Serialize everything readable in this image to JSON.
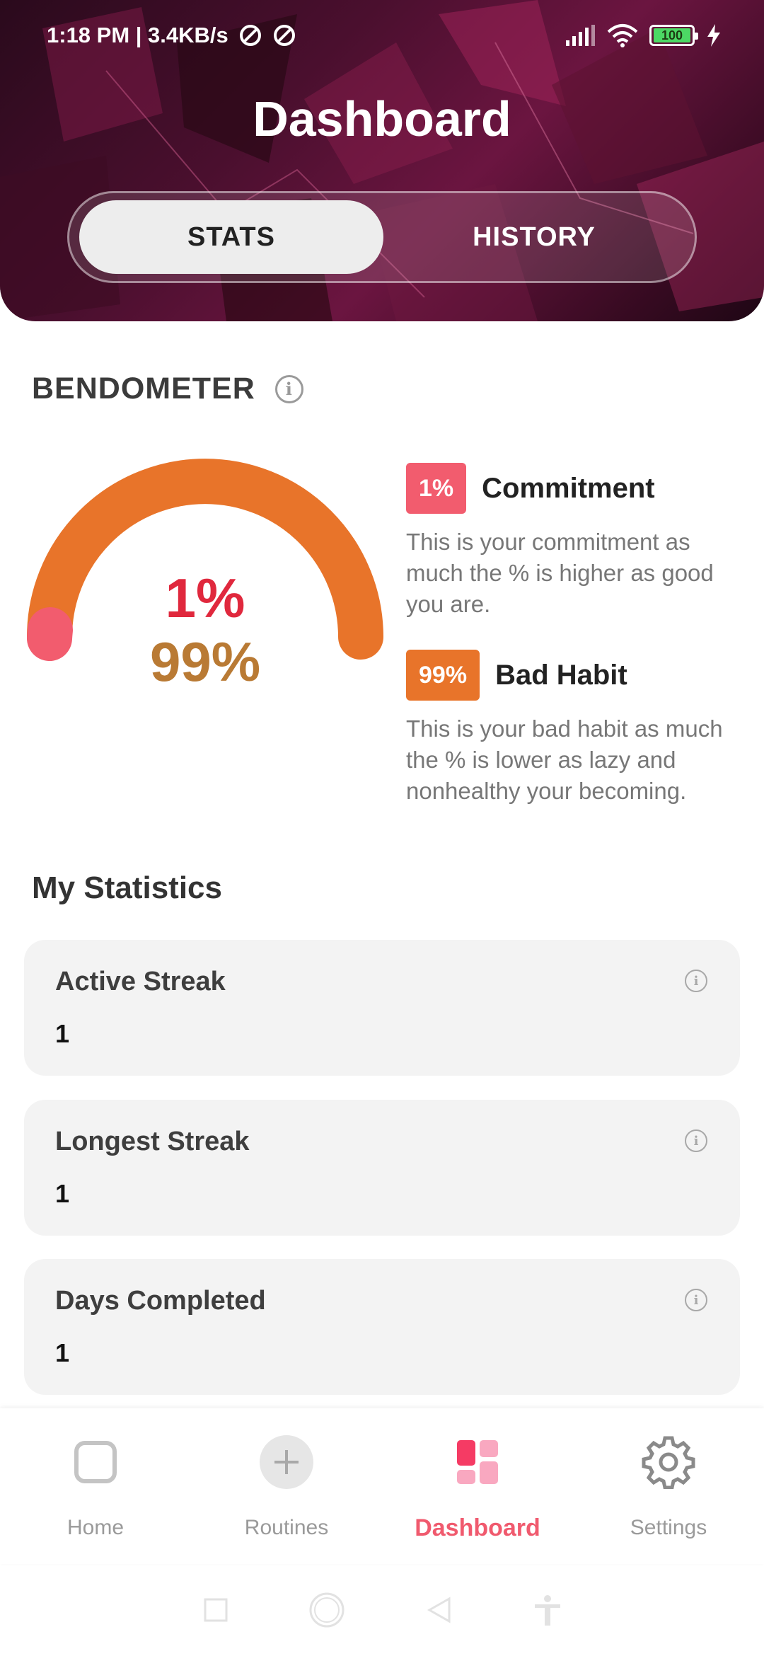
{
  "status_bar": {
    "time_speed": "1:18 PM | 3.4KB/s",
    "battery": "100"
  },
  "header": {
    "title": "Dashboard",
    "tabs": [
      {
        "label": "STATS",
        "active": true
      },
      {
        "label": "HISTORY",
        "active": false
      }
    ]
  },
  "bendometer": {
    "title": "BENDOMETER",
    "commitment_value": "1%",
    "bad_habit_value": "99%",
    "commitment": {
      "badge": "1%",
      "name": "Commitment",
      "description": "This is your commitment as much the % is higher as good you are."
    },
    "bad_habit": {
      "badge": "99%",
      "name": "Bad Habit",
      "description": "This is your bad habit as much the % is lower as lazy and nonhealthy your becoming."
    },
    "colors": {
      "commitment": "#f25c6e",
      "bad_habit": "#e8742a",
      "commitment_text": "#e0283d",
      "bad_habit_text": "#b97a34"
    }
  },
  "statistics": {
    "title": "My Statistics",
    "cards": [
      {
        "label": "Active Streak",
        "value": "1"
      },
      {
        "label": "Longest Streak",
        "value": "1"
      },
      {
        "label": "Days Completed",
        "value": "1"
      }
    ]
  },
  "bottom_nav": {
    "items": [
      {
        "label": "Home",
        "icon": "home-square-icon",
        "active": false
      },
      {
        "label": "Routines",
        "icon": "plus-circle-icon",
        "active": false
      },
      {
        "label": "Dashboard",
        "icon": "dashboard-grid-icon",
        "active": true
      },
      {
        "label": "Settings",
        "icon": "gear-icon",
        "active": false
      }
    ],
    "accent_color": "#f05a6e"
  }
}
